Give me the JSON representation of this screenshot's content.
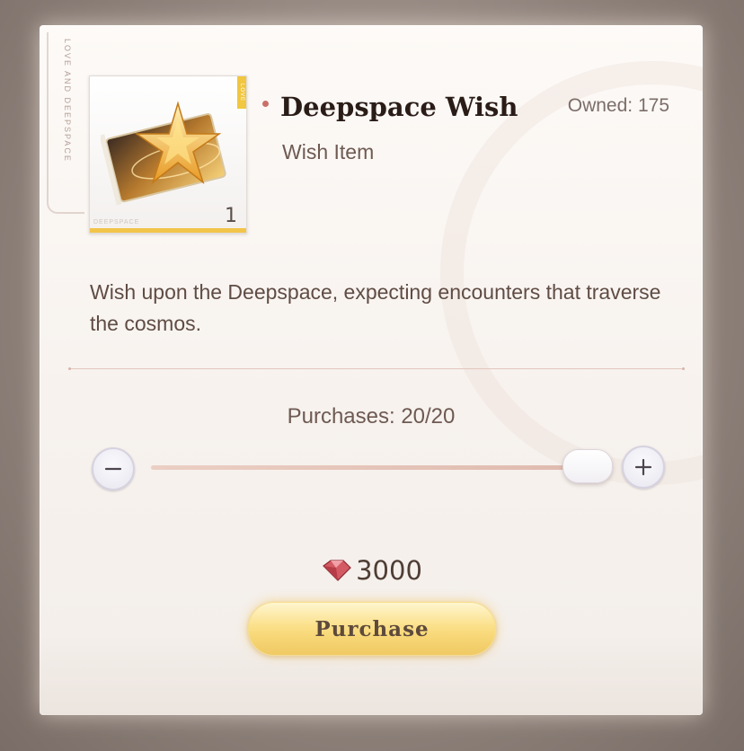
{
  "panel": {
    "side_label": "LOVE AND DEEPSPACE"
  },
  "item": {
    "name": "Deepspace Wish",
    "category": "Wish Item",
    "owned_label": "Owned: 175",
    "quantity": "1",
    "card_brand": "DEEPSPACE",
    "card_tag": "LOVE",
    "icon": "wish-ticket-icon"
  },
  "description": "Wish upon the Deepspace, expecting encounters that traverse the cosmos.",
  "purchase_control": {
    "purchases_label": "Purchases: 20/20",
    "slider_value": 20,
    "slider_max": 20,
    "minus_icon": "minus-icon",
    "plus_icon": "plus-icon"
  },
  "cost": {
    "amount": "3000",
    "currency_icon": "diamond-currency-icon"
  },
  "buttons": {
    "purchase_label": "Purchase"
  },
  "colors": {
    "accent_gold": "#f1c650",
    "bullet": "#c9706a",
    "currency": "#c9505a"
  }
}
